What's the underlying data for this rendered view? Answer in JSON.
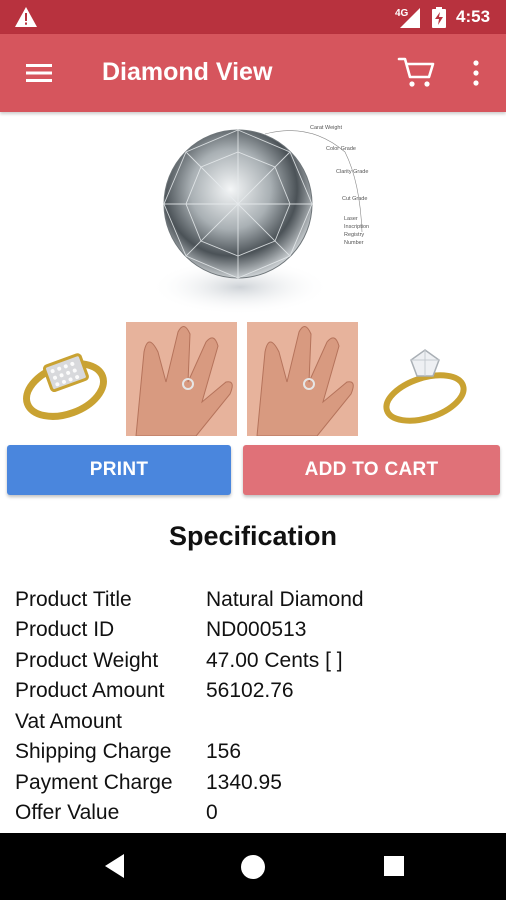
{
  "status": {
    "network": "4G",
    "time": "4:53"
  },
  "app_bar": {
    "title": "Diamond View"
  },
  "hero": {
    "labels": [
      "Carat Weight",
      "Color Grade",
      "Clarity Grade",
      "Cut Grade",
      "Laser",
      "Inscription",
      "Registry",
      "Number"
    ]
  },
  "actions": {
    "print_label": "PRINT",
    "add_to_cart_label": "ADD TO CART"
  },
  "specification": {
    "heading": "Specification",
    "rows": [
      {
        "label": "Product Title",
        "value": "Natural Diamond"
      },
      {
        "label": "Product ID",
        "value": "ND000513"
      },
      {
        "label": "Product Weight",
        "value": "47.00 Cents [ ]"
      },
      {
        "label": "Product Amount",
        "value": "56102.76"
      },
      {
        "label": "Vat Amount",
        "value": ""
      },
      {
        "label": "Shipping Charge",
        "value": "156"
      },
      {
        "label": "Payment Charge",
        "value": "1340.95"
      },
      {
        "label": "Offer Value",
        "value": "0"
      }
    ]
  },
  "colors": {
    "status_bar": "#b8323e",
    "app_bar": "#d6555d",
    "print": "#4a86dd",
    "add_to_cart": "#e07178"
  }
}
